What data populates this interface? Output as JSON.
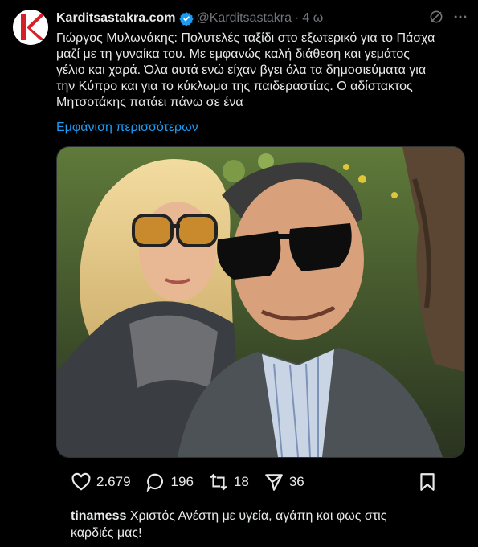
{
  "post": {
    "account_name": "Karditsastakra.com",
    "handle": "@Karditsastakra",
    "separator": "·",
    "time": "4 ω",
    "text": "Γιώργος Μυλωνάκης: Πολυτελές ταξίδι στο εξωτερικό για το Πάσχα\nμαζί με τη γυναίκα του. Με εμφανώς καλή διάθεση και γεμάτος\nγέλιο και χαρά. Όλα αυτά ενώ είχαν βγει όλα τα δημοσιεύματα για\nτην Κύπρο και για  το κύκλωμα της παιδεραστίας. Ο αδίστακτος\nΜητσοτάκης πατάει πάνω σε ένα",
    "show_more": "Εμφάνιση περισσότερων"
  },
  "stats": {
    "likes": "2.679",
    "replies": "196",
    "reposts": "18",
    "shares": "36"
  },
  "comment": {
    "user": "tinamess",
    "text": "Χριστός Ανέστη με υγεία, αγάπη και φως στις\nκαρδιές μας!"
  },
  "colors": {
    "background": "#000000",
    "accent": "#1d9bf0",
    "logo_red": "#d4202a",
    "muted": "#71767b"
  },
  "icons": [
    "verified-badge-icon",
    "grok-icon",
    "more-options-icon",
    "heart-icon",
    "reply-icon",
    "repost-icon",
    "share-icon",
    "bookmark-icon"
  ]
}
